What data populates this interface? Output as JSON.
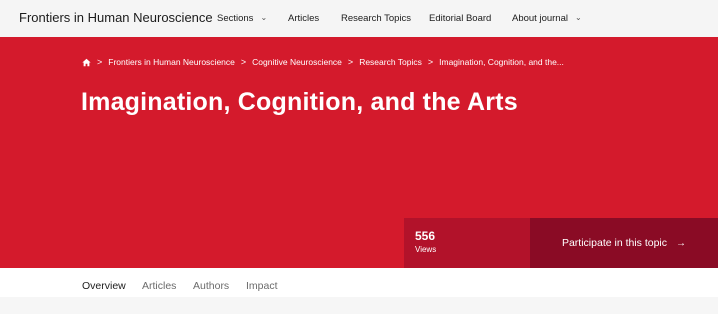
{
  "header": {
    "journal_name": "Frontiers in Human Neuroscience",
    "nav": [
      {
        "label": "Sections",
        "has_dropdown": true
      },
      {
        "label": "Articles",
        "has_dropdown": false
      },
      {
        "label": "Research Topics",
        "has_dropdown": false
      },
      {
        "label": "Editorial Board",
        "has_dropdown": false
      },
      {
        "label": "About journal",
        "has_dropdown": true
      }
    ]
  },
  "breadcrumb": {
    "items": [
      "Frontiers in Human Neuroscience",
      "Cognitive Neuroscience",
      "Research Topics",
      "Imagination, Cognition, and the..."
    ]
  },
  "hero": {
    "title": "Imagination, Cognition, and the Arts",
    "views_count": "556",
    "views_label": "Views",
    "participate_label": "Participate in this topic",
    "colors": {
      "background": "#d41a2c",
      "views_box": "#b2122a",
      "participate": "#8a0b25"
    }
  },
  "tabs": [
    {
      "label": "Overview",
      "active": true
    },
    {
      "label": "Articles",
      "active": false
    },
    {
      "label": "Authors",
      "active": false
    },
    {
      "label": "Impact",
      "active": false
    }
  ],
  "icons": {
    "home": "home-icon",
    "chevron": "chevron-down-icon",
    "separator": "chevron-right-icon",
    "arrow": "arrow-right-icon"
  }
}
